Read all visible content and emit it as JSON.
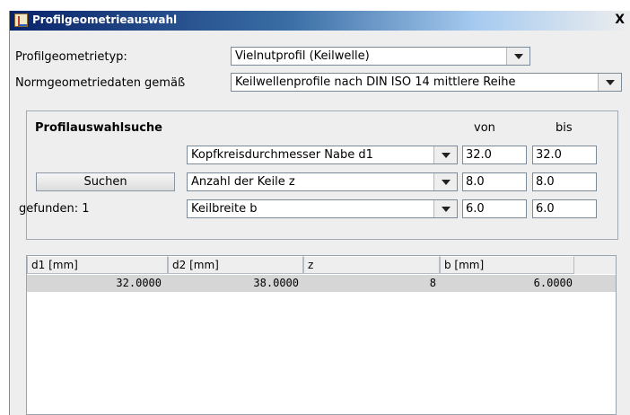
{
  "window": {
    "title": "Profilgeometrieauswahl",
    "close_glyph": "X"
  },
  "profiltyp": {
    "label": "Profilgeometrietyp:",
    "value": "Vielnutprofil (Keilwelle)"
  },
  "normdaten": {
    "label": "Normgeometriedaten gemäß",
    "value": "Keilwellenprofile nach DIN ISO 14 mittlere Reihe"
  },
  "search": {
    "title": "Profilauswahlsuche",
    "col_from": "von",
    "col_to": "bis",
    "button_label": "Suchen",
    "found_label": "gefunden: 1",
    "rows": [
      {
        "param": "Kopfkreisdurchmesser Nabe d1",
        "from": "32.0",
        "to": "32.0"
      },
      {
        "param": "Anzahl der Keile z",
        "from": "8.0",
        "to": "8.0"
      },
      {
        "param": "Keilbreite b",
        "from": "6.0",
        "to": "6.0"
      }
    ]
  },
  "table": {
    "columns": [
      "d1 [mm]",
      "d2 [mm]",
      "z",
      "b [mm]"
    ],
    "rows": [
      [
        "32.0000",
        "38.0000",
        "8",
        "6.0000"
      ]
    ]
  },
  "icons": {
    "window_icon": "java-cup-icon",
    "dropdown": "triangle-down-icon"
  }
}
